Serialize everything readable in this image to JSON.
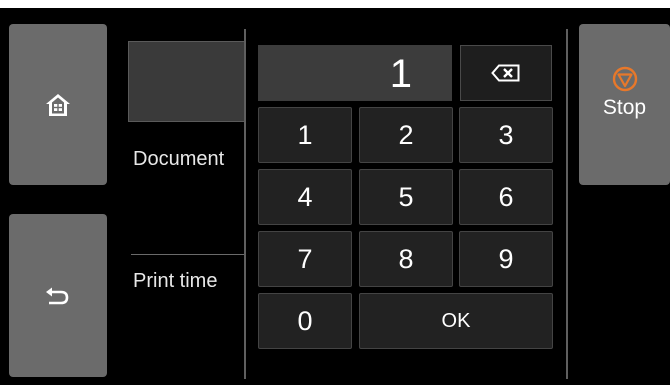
{
  "left_nav": {
    "home_icon": "home-icon",
    "back_icon": "back-arrow-icon"
  },
  "background": {
    "document_label": "Document",
    "print_time_label": "Print time"
  },
  "keypad": {
    "display_value": "1",
    "backspace_icon": "backspace-icon",
    "keys": {
      "k1": "1",
      "k2": "2",
      "k3": "3",
      "k4": "4",
      "k5": "5",
      "k6": "6",
      "k7": "7",
      "k8": "8",
      "k9": "9",
      "k0": "0",
      "ok": "OK"
    }
  },
  "stop": {
    "label": "Stop",
    "icon": "stop-icon",
    "icon_color": "#e8782a"
  },
  "colors": {
    "screen_bg": "#000000",
    "side_button": "#6b6b6b",
    "display_bg": "#3c3c3c",
    "key_bg": "#222222"
  }
}
